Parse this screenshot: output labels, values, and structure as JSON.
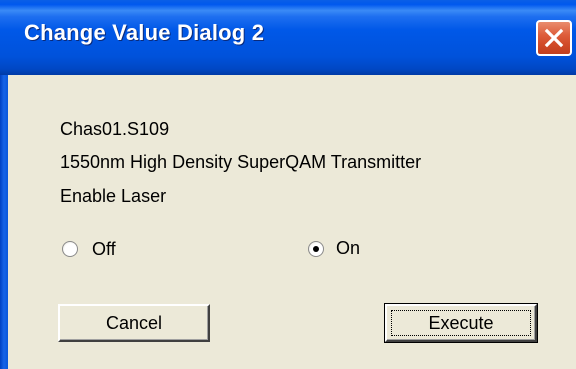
{
  "window": {
    "title": "Change Value Dialog 2",
    "close_icon": "close-icon"
  },
  "info": {
    "chassis": "Chas01.S109",
    "device": "1550nm High Density SuperQAM Transmitter",
    "parameter": "Enable Laser"
  },
  "options": [
    {
      "label": "Off",
      "selected": false
    },
    {
      "label": "On",
      "selected": true
    }
  ],
  "buttons": {
    "cancel_label": "Cancel",
    "execute_label": "Execute"
  },
  "colors": {
    "titlebar": "#0054e3",
    "close_button": "#d85030",
    "dialog_face": "#ece9d8"
  }
}
